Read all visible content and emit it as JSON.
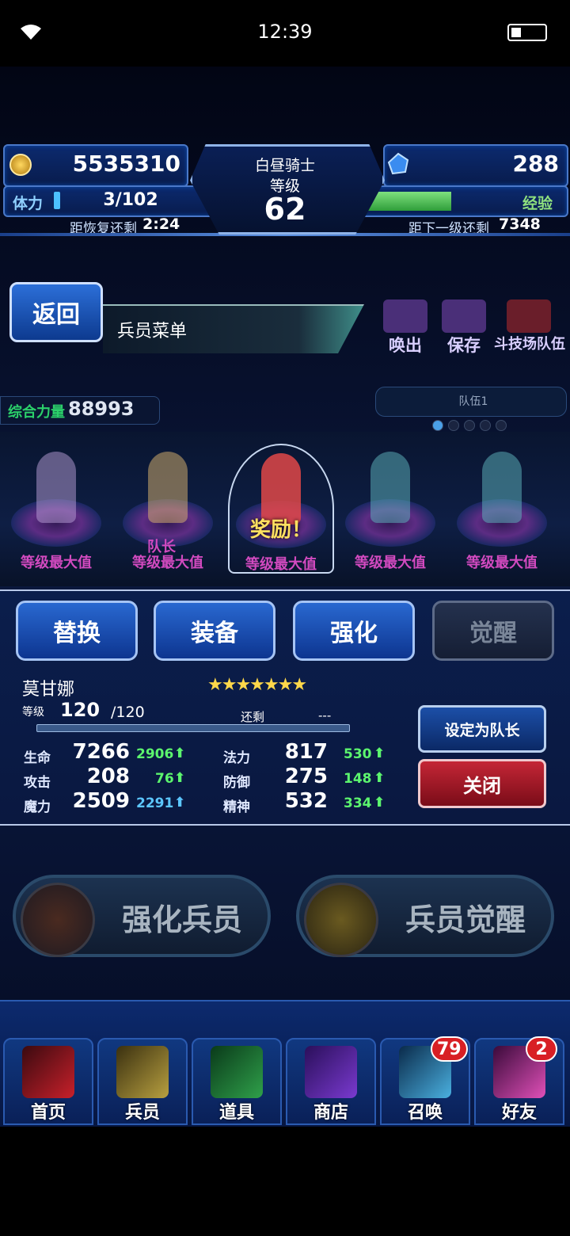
{
  "status_bar": {
    "time": "12:39",
    "icons": [
      "wifi-icon",
      "battery-icon"
    ]
  },
  "header": {
    "gil": "5535310",
    "gems": "288",
    "stamina_label": "体力",
    "stamina_value": "3/102",
    "stamina_fill": 0.03,
    "recover_label": "距恢复还剩",
    "recover_time": "2:24",
    "title_name": "白昼骑士",
    "level_label": "等级",
    "level_value": "62",
    "exp_label": "经验",
    "exp_fill": 0.55,
    "next_label": "距下一级还剩",
    "next_value": "7348"
  },
  "nav": {
    "back_label": "返回",
    "screen_title": "兵员菜单",
    "team_buttons": [
      {
        "label": "唤出",
        "icon": "team-load-icon"
      },
      {
        "label": "保存",
        "icon": "team-save-icon"
      },
      {
        "label": "斗技场队伍",
        "icon": "arena-team-icon"
      }
    ]
  },
  "party": {
    "power_label": "综合力量",
    "power_value": "88993",
    "party_label": "队伍1",
    "leader_tag": "队长",
    "reward_label": "奖励！",
    "units": [
      {
        "state": "等级最大值",
        "color": "#b9a0d8"
      },
      {
        "state": "等级最大值",
        "color": "#e0b870"
      },
      {
        "state": "等级最大值",
        "color": "#e04848"
      },
      {
        "state": "等级最大值",
        "color": "#5fb8c0"
      },
      {
        "state": "等级最大值",
        "color": "#5fb8c0"
      }
    ]
  },
  "actions": [
    {
      "label": "替换",
      "enabled": true
    },
    {
      "label": "装备",
      "enabled": true
    },
    {
      "label": "强化",
      "enabled": true
    },
    {
      "label": "觉醒",
      "enabled": false
    }
  ],
  "unit": {
    "name": "莫甘娜",
    "stars": "★★★★★★★",
    "level_label": "等级",
    "level": "120",
    "level_max": "/120",
    "remain_label": "还剩",
    "remain_value": "---",
    "stats": [
      {
        "label": "生命",
        "value": "7266",
        "bonus": "2906",
        "bonus_color": "green"
      },
      {
        "label": "法力",
        "value": "817",
        "bonus": "530",
        "bonus_color": "green"
      },
      {
        "label": "攻击",
        "value": "208",
        "bonus": "76",
        "bonus_color": "green"
      },
      {
        "label": "防御",
        "value": "275",
        "bonus": "148",
        "bonus_color": "green"
      },
      {
        "label": "魔力",
        "value": "2509",
        "bonus": "2291",
        "bonus_color": "blue"
      },
      {
        "label": "精神",
        "value": "532",
        "bonus": "334",
        "bonus_color": "green"
      }
    ],
    "set_leader_label": "设定为队长",
    "close_label": "关闭"
  },
  "big_buttons": [
    {
      "label": "强化兵员",
      "icon": "enhance-medal-icon"
    },
    {
      "label": "兵员觉醒",
      "icon": "awaken-medal-icon"
    }
  ],
  "bottom_nav": [
    {
      "label": "首页",
      "icon": "sword-home-icon",
      "color": "#c8202a"
    },
    {
      "label": "兵员",
      "icon": "unit-hero-icon",
      "color": "#b8a040"
    },
    {
      "label": "道具",
      "icon": "potion-icon",
      "color": "#2fa04a"
    },
    {
      "label": "商店",
      "icon": "shop-icon",
      "color": "#7a3ad0"
    },
    {
      "label": "召唤",
      "icon": "summon-crystal-icon",
      "color": "#4ab0e0",
      "badge": "79"
    },
    {
      "label": "好友",
      "icon": "friends-icon",
      "color": "#e050b8",
      "badge": "2"
    }
  ]
}
